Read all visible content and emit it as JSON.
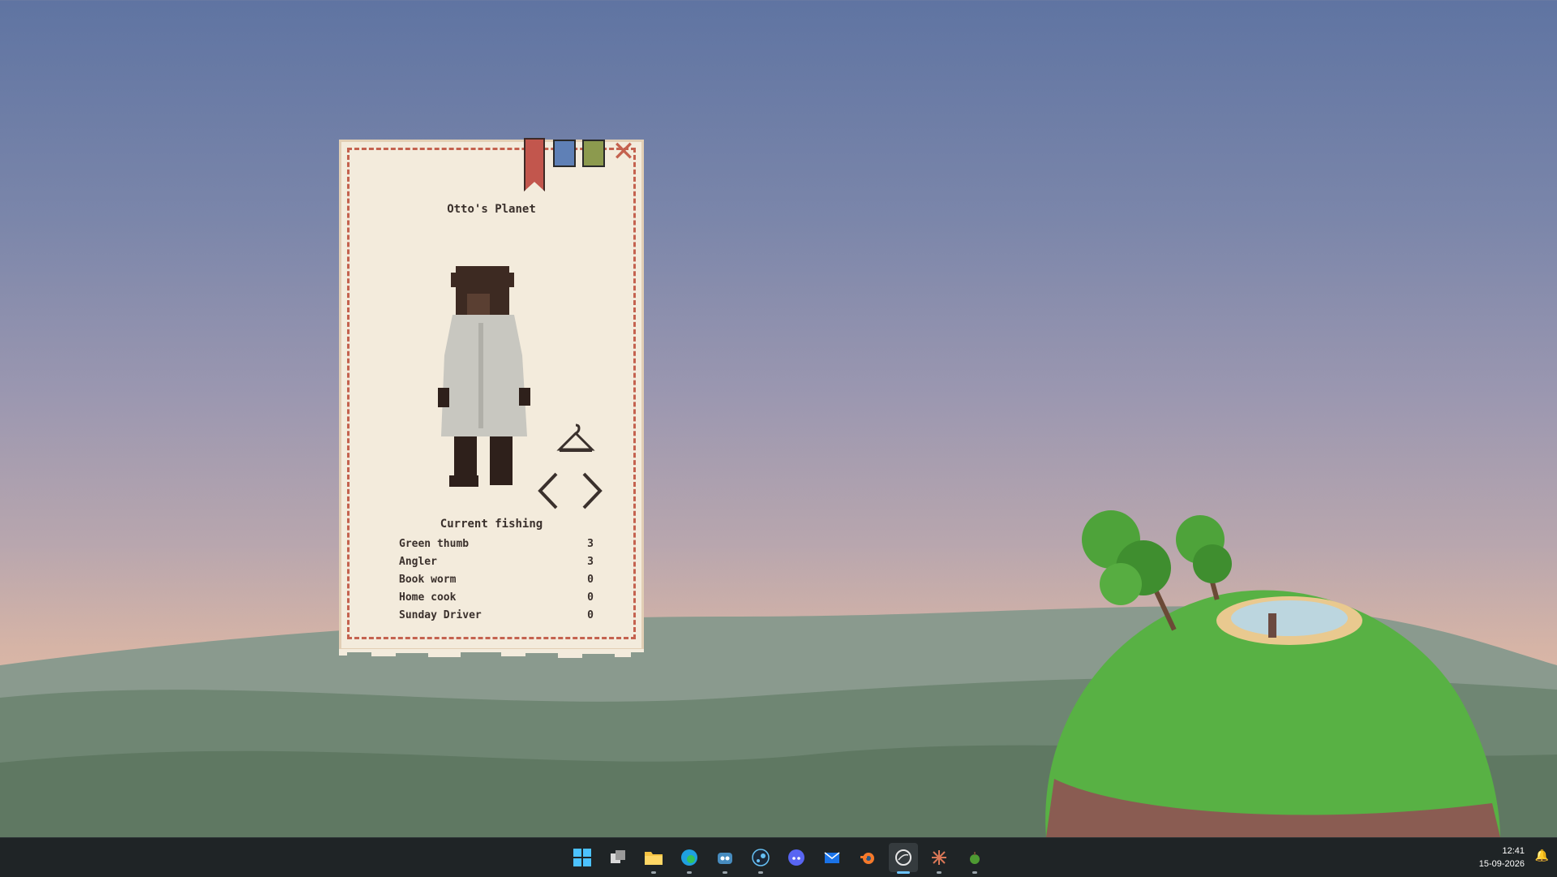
{
  "card": {
    "title": "Otto's Planet",
    "section_title": "Current fishing",
    "stats": [
      {
        "label": "Green thumb",
        "value": "3"
      },
      {
        "label": "Angler",
        "value": "3"
      },
      {
        "label": "Book worm",
        "value": "0"
      },
      {
        "label": "Home cook",
        "value": "0"
      },
      {
        "label": "Sunday Driver",
        "value": "0"
      }
    ],
    "bookmark_colors": {
      "red": "#c2564d",
      "blue": "#5f80b6",
      "green": "#8c9a4e"
    },
    "close_icon": "close-icon"
  },
  "taskbar": {
    "icons": [
      "windows-start-icon",
      "task-view-icon",
      "file-explorer-icon",
      "edge-icon",
      "godot-icon",
      "steam-icon",
      "discord-icon",
      "mail-icon",
      "blender-icon",
      "app-active-icon",
      "claude-icon",
      "planet-app-icon"
    ],
    "time": "12:41",
    "date": "15-09-2026"
  },
  "colors": {
    "taskbar_bg": "#1f2426",
    "card_bg": "#f3ebdc",
    "card_border": "#c4624f"
  }
}
